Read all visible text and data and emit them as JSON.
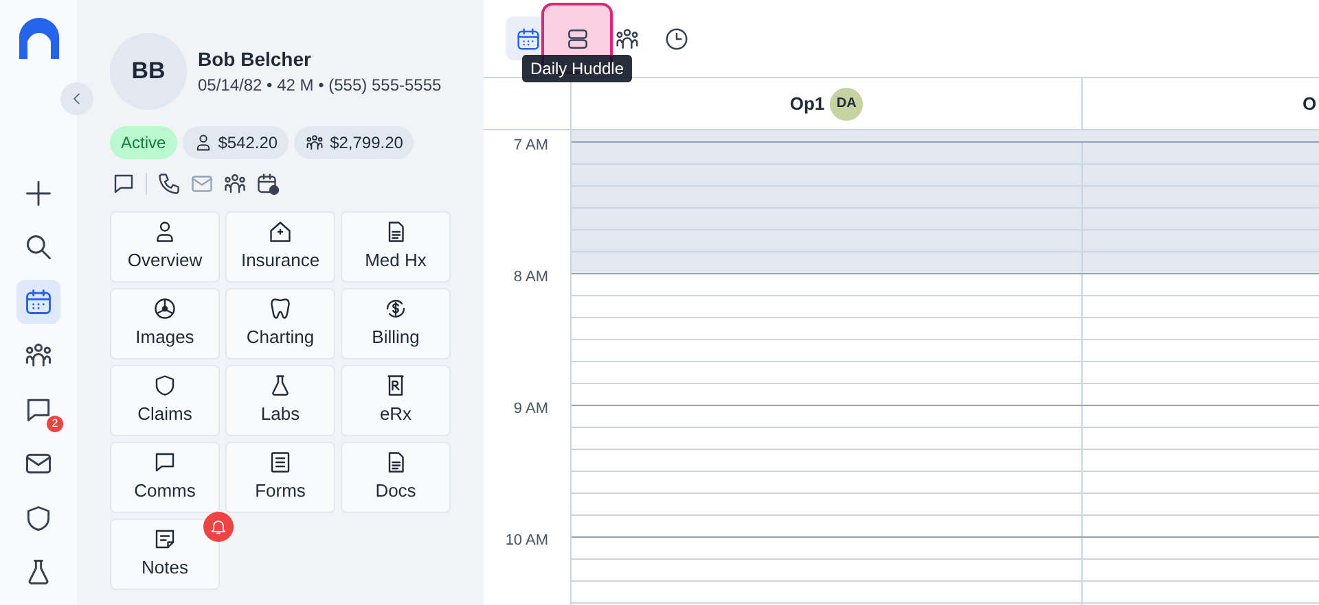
{
  "rail": {
    "items": [
      {
        "selected": false
      },
      {
        "selected": false
      },
      {
        "selected": true
      },
      {
        "selected": false
      },
      {
        "selected": false,
        "badge": "2"
      },
      {
        "selected": false
      },
      {
        "selected": false
      },
      {
        "selected": false
      }
    ]
  },
  "patient": {
    "initials": "BB",
    "name": "Bob Belcher",
    "details": "05/14/82 • 42 M • (555) 555-5555",
    "status": "Active",
    "balances": [
      {
        "amount": "$542.20"
      },
      {
        "amount": "$2,799.20"
      }
    ],
    "actions": [
      {
        "disabled": false
      },
      {
        "disabled": false
      },
      {
        "disabled": true
      },
      {
        "disabled": false
      },
      {
        "disabled": false
      }
    ],
    "tiles": [
      {
        "label": "Overview",
        "alert": false
      },
      {
        "label": "Insurance",
        "alert": false
      },
      {
        "label": "Med Hx",
        "alert": false
      },
      {
        "label": "Images",
        "alert": false
      },
      {
        "label": "Charting",
        "alert": false
      },
      {
        "label": "Billing",
        "alert": false
      },
      {
        "label": "Claims",
        "alert": false
      },
      {
        "label": "Labs",
        "alert": false
      },
      {
        "label": "eRx",
        "alert": false
      },
      {
        "label": "Comms",
        "alert": false
      },
      {
        "label": "Forms",
        "alert": false
      },
      {
        "label": "Docs",
        "alert": false
      },
      {
        "label": "Notes",
        "alert": true
      }
    ]
  },
  "toolbar": {
    "buttons": [
      {
        "selected": true,
        "hovered": false
      },
      {
        "selected": false,
        "hovered": true
      },
      {
        "selected": false,
        "hovered": false
      },
      {
        "selected": false,
        "hovered": false
      }
    ],
    "tooltip": "Daily Huddle"
  },
  "schedule": {
    "columns": [
      {
        "name": "Op1",
        "provider": "DA"
      },
      {
        "name": "O"
      }
    ],
    "hours": [
      {
        "label": "7 AM",
        "blocked": true
      },
      {
        "label": "8 AM",
        "blocked": false
      },
      {
        "label": "9 AM",
        "blocked": false
      },
      {
        "label": "10 AM",
        "blocked": false
      }
    ]
  }
}
